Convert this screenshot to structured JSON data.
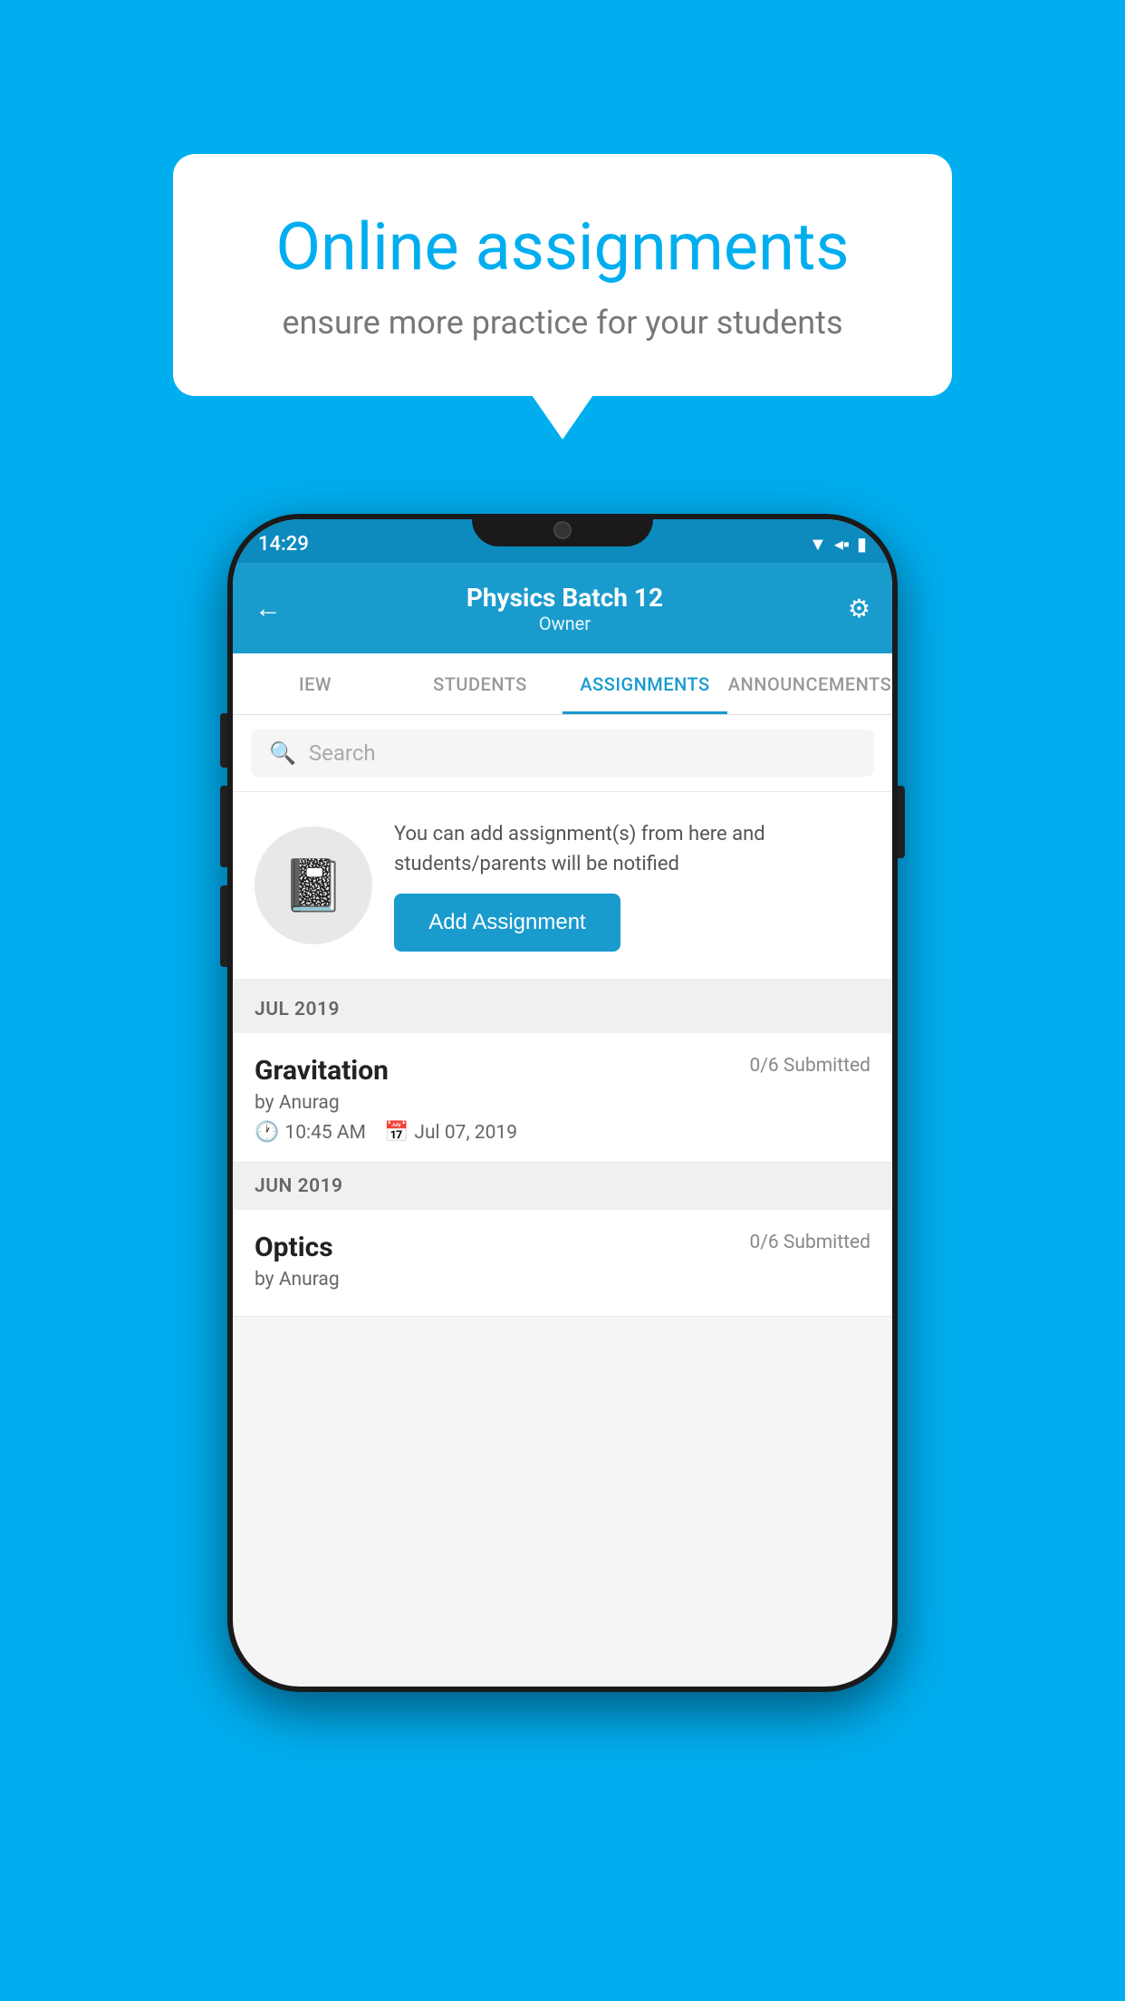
{
  "background_color": "#00AEEF",
  "speech_bubble": {
    "title": "Online assignments",
    "subtitle": "ensure more practice for your students"
  },
  "phone": {
    "status_bar": {
      "time": "14:29",
      "icons": [
        "wifi",
        "signal",
        "battery"
      ]
    },
    "header": {
      "title": "Physics Batch 12",
      "subtitle": "Owner",
      "back_label": "←",
      "gear_label": "⚙"
    },
    "tabs": [
      {
        "label": "IEW",
        "active": false
      },
      {
        "label": "STUDENTS",
        "active": false
      },
      {
        "label": "ASSIGNMENTS",
        "active": true
      },
      {
        "label": "ANNOUNCEMENTS",
        "active": false
      }
    ],
    "search": {
      "placeholder": "Search"
    },
    "promo_card": {
      "text": "You can add assignment(s) from here and students/parents will be notified",
      "button_label": "Add Assignment"
    },
    "sections": [
      {
        "label": "JUL 2019",
        "assignments": [
          {
            "title": "Gravitation",
            "submitted": "0/6 Submitted",
            "by": "by Anurag",
            "time": "10:45 AM",
            "date": "Jul 07, 2019"
          }
        ]
      },
      {
        "label": "JUN 2019",
        "assignments": [
          {
            "title": "Optics",
            "submitted": "0/6 Submitted",
            "by": "by Anurag",
            "time": "",
            "date": ""
          }
        ]
      }
    ]
  }
}
